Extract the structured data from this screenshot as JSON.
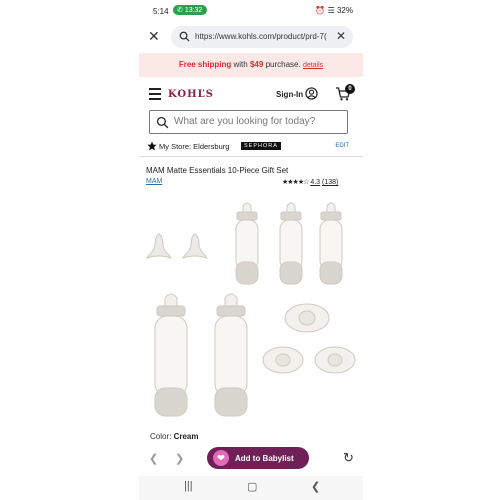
{
  "status": {
    "time": "5:14",
    "call": "13:32",
    "battery": "32%"
  },
  "browser": {
    "url": "https://www.kohls.com/product/prd-7("
  },
  "promo": {
    "strong": "Free shipping",
    "with": "with",
    "amount": "$49",
    "purchase": "purchase.",
    "details": "details"
  },
  "header": {
    "logo": "KOHĽS",
    "signin": "Sign-In",
    "cart_count": "0"
  },
  "search": {
    "placeholder": "What are you looking for today?"
  },
  "store": {
    "label": "My Store: Eldersburg",
    "sephora": "SEPHORA",
    "edit": "EDIT"
  },
  "product": {
    "title": "MAM Matte Essentials 10-Piece Gift Set",
    "brand": "MAM",
    "rating_value": "4.3",
    "review_count": "(138)",
    "rating": 4.3,
    "color_label": "Color:",
    "color_value": "Cream"
  },
  "actions": {
    "add_label": "Add to Babylist"
  },
  "colors": {
    "accent": "#6f2157",
    "heart": "#e26ab9",
    "promo_red": "#d32f2f",
    "link": "#2a6fb0",
    "bottle": "#d9d6cf"
  }
}
